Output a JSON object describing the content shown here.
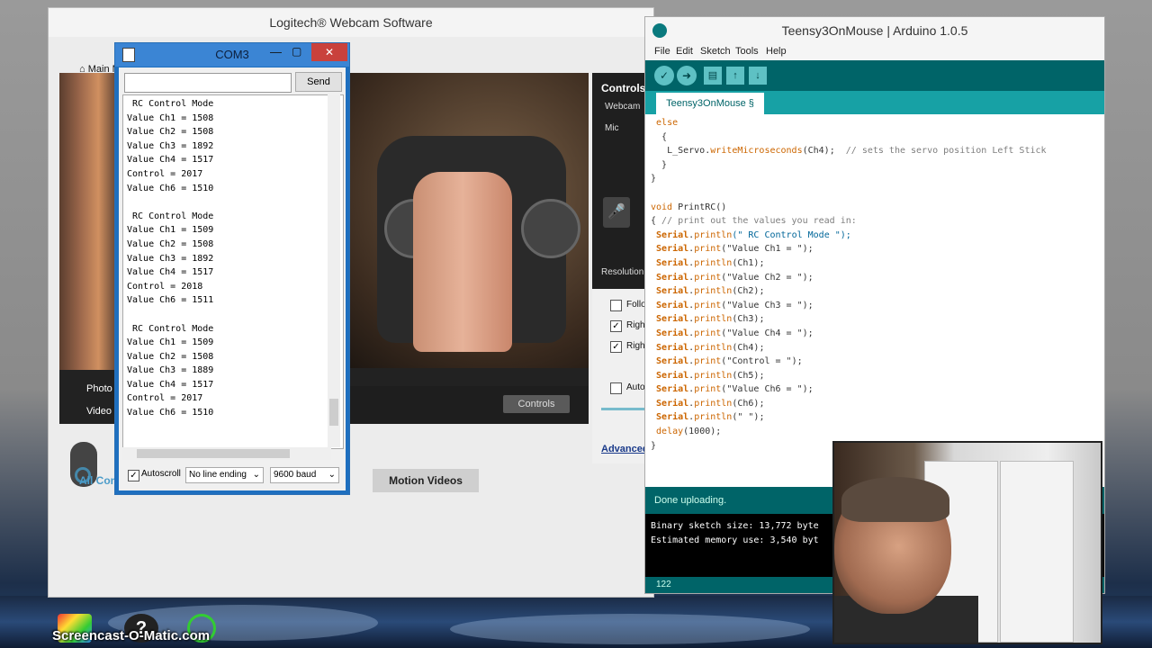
{
  "desktop": {
    "watermark": "Screencast-O-Matic.com"
  },
  "logitech": {
    "title": "Logitech® Webcam Software",
    "main_menu": "Main Me",
    "controls_title": "Controls",
    "webcam_label": "Webcam",
    "mic_label": "Mic",
    "resolution_label": "Resolution",
    "checks": [
      "Follo",
      "Righ",
      "Righ"
    ],
    "auto_label": "Auto",
    "advanced_label": "Advanced",
    "controls_button": "Controls",
    "photo_label": "Photo",
    "video_label": "Video",
    "tab_all": "All Cont",
    "tab_motion": "Motion Videos"
  },
  "com3": {
    "title": "COM3",
    "send_label": "Send",
    "input_value": "",
    "output_lines": [
      " RC Control Mode",
      "Value Ch1 = 1508",
      "Value Ch2 = 1508",
      "Value Ch3 = 1892",
      "Value Ch4 = 1517",
      "Control = 2017",
      "Value Ch6 = 1510",
      "",
      " RC Control Mode",
      "Value Ch1 = 1509",
      "Value Ch2 = 1508",
      "Value Ch3 = 1892",
      "Value Ch4 = 1517",
      "Control = 2018",
      "Value Ch6 = 1511",
      "",
      " RC Control Mode",
      "Value Ch1 = 1509",
      "Value Ch2 = 1508",
      "Value Ch3 = 1889",
      "Value Ch4 = 1517",
      "Control = 2017",
      "Value Ch6 = 1510"
    ],
    "autoscroll_label": "Autoscroll",
    "line_ending": "No line ending",
    "baud": "9600 baud"
  },
  "arduino": {
    "title": "Teensy3OnMouse | Arduino 1.0.5",
    "menu": [
      "File",
      "Edit",
      "Sketch",
      "Tools",
      "Help"
    ],
    "tab_label": "Teensy3OnMouse §",
    "code": {
      "l1": "else",
      "l2": "{",
      "l3a": "L_Servo.",
      "l3b": "writeMicroseconds",
      "l3c": "(Ch4);  ",
      "l3d": "// sets the servo position Left Stick",
      "l4": "}",
      "l5": "}",
      "l6a": "void",
      "l6b": " PrintRC()",
      "l7a": "{ ",
      "l7b": "// print out the values you read in:",
      "serial": "Serial",
      "println": "println",
      "print": "print",
      "s1": "(\" RC Control Mode \");",
      "s2": "(\"Value Ch1 = \");",
      "s3": "(Ch1);",
      "s4": "(\"Value Ch2 = \");",
      "s5": "(Ch2);",
      "s6": "(\"Value Ch3 = \");",
      "s7": "(Ch3);",
      "s8": "(\"Value Ch4 = \");",
      "s9": "(Ch4);",
      "s10": "(\"Control = \");",
      "s11": "(Ch5);",
      "s12": "(\"Value Ch6 = \");",
      "s13": "(Ch6);",
      "s14": "(\" \");",
      "delay": "delay",
      "delay_args": "(1000);",
      "close": "}"
    },
    "status": "Done uploading.",
    "console": [
      "Binary sketch size: 13,772 byte",
      "Estimated memory use: 3,540 byt"
    ],
    "line_number": "122"
  }
}
